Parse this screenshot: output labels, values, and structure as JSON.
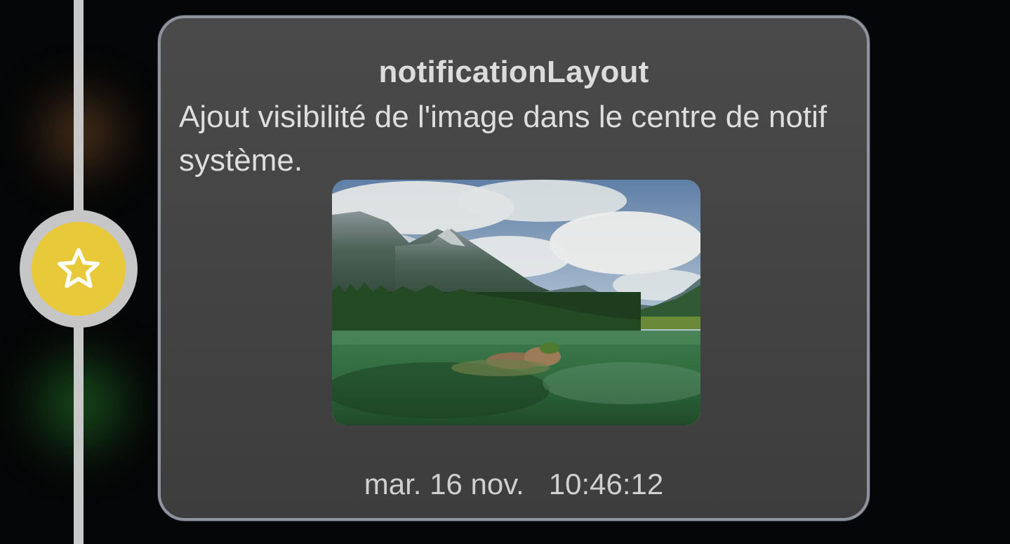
{
  "notification": {
    "title": "notificationLayout",
    "body": "Ajout visibilité de l'image dans le centre de notif système.",
    "date": "mar. 16 nov.",
    "time": "10:46:12"
  },
  "timeline": {
    "node_icon": "star-outline-icon",
    "node_color": "#e8c93a",
    "line_color": "#c8c8c8"
  },
  "image": {
    "subject": "landscape-photo"
  }
}
